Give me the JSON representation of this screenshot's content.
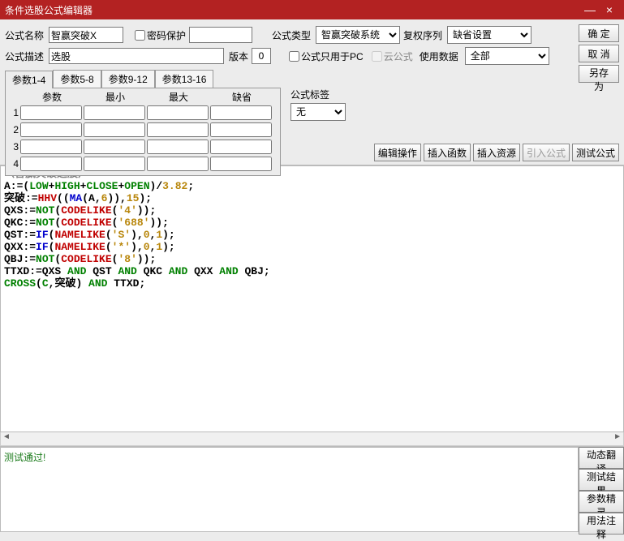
{
  "window": {
    "title": "条件选股公式编辑器",
    "minimize": "—",
    "close": "×"
  },
  "labels": {
    "name": "公式名称",
    "pwdprotect": "密码保护",
    "desc": "公式描述",
    "version": "版本",
    "ftype": "公式类型",
    "fuquan": "复权序列",
    "pconly": "公式只用于PC",
    "cloud": "云公式",
    "usedata": "使用数据",
    "ftag": "公式标签"
  },
  "values": {
    "name": "智赢突破X",
    "pwdfield": "",
    "desc": "选股",
    "version": "0",
    "ftype": "智赢突破系统",
    "fuquan": "缺省设置",
    "usedata": "全部",
    "ftag": "无"
  },
  "checks": {
    "pwdprotect": false,
    "pconly": false,
    "cloud": false
  },
  "buttons": {
    "ok": "确  定",
    "cancel": "取  消",
    "saveas": "另存为",
    "editop": "编辑操作",
    "insfunc": "插入函数",
    "insres": "插入资源",
    "import": "引入公式",
    "test": "测试公式",
    "dyntrans": "动态翻译",
    "testres": "测试结果",
    "paramwiz": "参数精灵",
    "usage": "用法注释"
  },
  "paramTabs": [
    "参数1-4",
    "参数5-8",
    "参数9-12",
    "参数13-16"
  ],
  "paramHeaders": {
    "p": "参数",
    "min": "最小",
    "max": "最大",
    "def": "缺省"
  },
  "paramRows": [
    "1",
    "2",
    "3",
    "4"
  ],
  "code": {
    "title": "〈智赢突破选股〉",
    "lines": [
      [
        {
          "t": "A:=(",
          "c": ""
        },
        {
          "t": "LOW",
          "c": "green"
        },
        {
          "t": "+",
          "c": ""
        },
        {
          "t": "HIGH",
          "c": "green"
        },
        {
          "t": "+",
          "c": ""
        },
        {
          "t": "CLOSE",
          "c": "green"
        },
        {
          "t": "+",
          "c": ""
        },
        {
          "t": "OPEN",
          "c": "green"
        },
        {
          "t": ")/",
          "c": ""
        },
        {
          "t": "3.82",
          "c": "brown"
        },
        {
          "t": ";",
          "c": ""
        }
      ],
      [
        {
          "t": "突破:=",
          "c": ""
        },
        {
          "t": "HHV",
          "c": "red"
        },
        {
          "t": "((",
          "c": ""
        },
        {
          "t": "MA",
          "c": "blue"
        },
        {
          "t": "(A,",
          "c": ""
        },
        {
          "t": "6",
          "c": "brown"
        },
        {
          "t": ")),",
          "c": ""
        },
        {
          "t": "15",
          "c": "brown"
        },
        {
          "t": ");",
          "c": ""
        }
      ],
      [
        {
          "t": "QXS:=",
          "c": ""
        },
        {
          "t": "NOT",
          "c": "green"
        },
        {
          "t": "(",
          "c": ""
        },
        {
          "t": "CODELIKE",
          "c": "red"
        },
        {
          "t": "(",
          "c": ""
        },
        {
          "t": "'4'",
          "c": "brown"
        },
        {
          "t": "));",
          "c": ""
        }
      ],
      [
        {
          "t": "QKC:=",
          "c": ""
        },
        {
          "t": "NOT",
          "c": "green"
        },
        {
          "t": "(",
          "c": ""
        },
        {
          "t": "CODELIKE",
          "c": "red"
        },
        {
          "t": "(",
          "c": ""
        },
        {
          "t": "'688'",
          "c": "brown"
        },
        {
          "t": "));",
          "c": ""
        }
      ],
      [
        {
          "t": "QST:=",
          "c": ""
        },
        {
          "t": "IF",
          "c": "blue"
        },
        {
          "t": "(",
          "c": ""
        },
        {
          "t": "NAMELIKE",
          "c": "red"
        },
        {
          "t": "(",
          "c": ""
        },
        {
          "t": "'S'",
          "c": "brown"
        },
        {
          "t": "),",
          "c": ""
        },
        {
          "t": "0",
          "c": "brown"
        },
        {
          "t": ",",
          "c": ""
        },
        {
          "t": "1",
          "c": "brown"
        },
        {
          "t": ");",
          "c": ""
        }
      ],
      [
        {
          "t": "QXX:=",
          "c": ""
        },
        {
          "t": "IF",
          "c": "blue"
        },
        {
          "t": "(",
          "c": ""
        },
        {
          "t": "NAMELIKE",
          "c": "red"
        },
        {
          "t": "(",
          "c": ""
        },
        {
          "t": "'*'",
          "c": "brown"
        },
        {
          "t": "),",
          "c": ""
        },
        {
          "t": "0",
          "c": "brown"
        },
        {
          "t": ",",
          "c": ""
        },
        {
          "t": "1",
          "c": "brown"
        },
        {
          "t": ");",
          "c": ""
        }
      ],
      [
        {
          "t": "QBJ:=",
          "c": ""
        },
        {
          "t": "NOT",
          "c": "green"
        },
        {
          "t": "(",
          "c": ""
        },
        {
          "t": "CODELIKE",
          "c": "red"
        },
        {
          "t": "(",
          "c": ""
        },
        {
          "t": "'8'",
          "c": "brown"
        },
        {
          "t": "));",
          "c": ""
        }
      ],
      [
        {
          "t": "TTXD:=QXS ",
          "c": ""
        },
        {
          "t": "AND",
          "c": "green"
        },
        {
          "t": " QST ",
          "c": ""
        },
        {
          "t": "AND",
          "c": "green"
        },
        {
          "t": " QKC ",
          "c": ""
        },
        {
          "t": "AND",
          "c": "green"
        },
        {
          "t": " QXX ",
          "c": ""
        },
        {
          "t": "AND",
          "c": "green"
        },
        {
          "t": " QBJ;",
          "c": ""
        }
      ],
      [
        {
          "t": "CROSS",
          "c": "green"
        },
        {
          "t": "(",
          "c": ""
        },
        {
          "t": "C",
          "c": "green"
        },
        {
          "t": ",突破) ",
          "c": ""
        },
        {
          "t": "AND",
          "c": "green"
        },
        {
          "t": " TTXD;",
          "c": ""
        }
      ]
    ]
  },
  "result": "测试通过!"
}
